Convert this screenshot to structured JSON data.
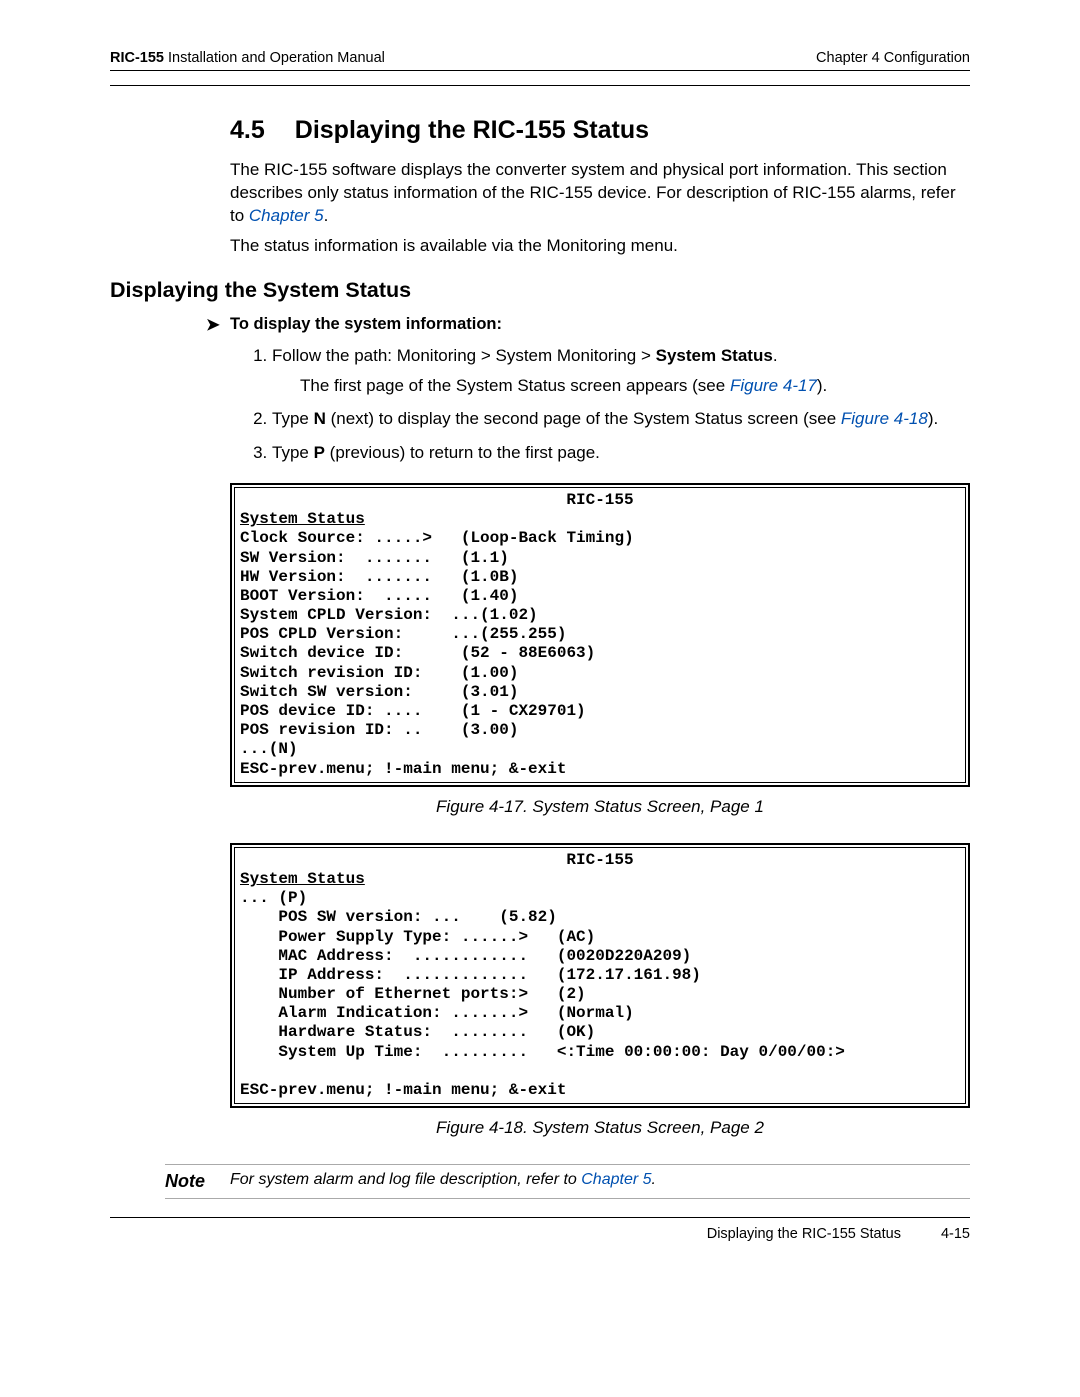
{
  "header": {
    "product": "RIC-155",
    "doc_title": "Installation and Operation Manual",
    "chapter": "Chapter 4  Configuration"
  },
  "section": {
    "number": "4.5",
    "title": "Displaying the RIC-155 Status"
  },
  "intro": {
    "p1": "The RIC-155 software displays the converter system and physical port information. This section describes only status information of the RIC-155 device. For description of RIC-155 alarms, refer to ",
    "chapter5_link": "Chapter 5",
    "p1_end": ".",
    "p2": "The status information is available via the Monitoring menu."
  },
  "sub_heading": "Displaying the System Status",
  "proc_title": "To display the system information:",
  "steps": {
    "s1_a": "Follow the path: Monitoring > System Monitoring > ",
    "s1_b": "System Status",
    "s1_c": ".",
    "s1_sub_a": "The first page of the System Status screen appears (see ",
    "s1_sub_link": "Figure 4-17",
    "s1_sub_b": ").",
    "s2_a": "Type ",
    "s2_n": "N",
    "s2_b": " (next) to display the second page of the System Status screen (see ",
    "s2_link": "Figure 4-18",
    "s2_c": ").",
    "s3_a": "Type ",
    "s3_p": "P",
    "s3_b": " (previous) to return to the first page."
  },
  "screen1": {
    "title": "RIC-155",
    "subtitle": "System Status",
    "lines": [
      "Clock Source: .....>   (Loop-Back Timing)",
      "SW Version:  .......   (1.1)",
      "HW Version:  .......   (1.0B)",
      "BOOT Version:  .....   (1.40)",
      "System CPLD Version:  ...(1.02)",
      "POS CPLD Version:     ...(255.255)",
      "Switch device ID:      (52 - 88E6063)",
      "Switch revision ID:    (1.00)",
      "Switch SW version:     (3.01)",
      "POS device ID: ....    (1 - CX29701)",
      "POS revision ID: ..    (3.00)",
      "...(N)"
    ],
    "footer": "ESC-prev.menu; !-main menu; &-exit",
    "caption": "Figure 4-17.  System Status Screen, Page 1"
  },
  "screen2": {
    "title": "RIC-155",
    "subtitle": "System Status",
    "lines": [
      "... (P)",
      "    POS SW version: ...    (5.82)",
      "    Power Supply Type: ......>   (AC)",
      "    MAC Address:  ............   (0020D220A209)",
      "    IP Address:  .............   (172.17.161.98)",
      "    Number of Ethernet ports:>   (2)",
      "    Alarm Indication: .......>   (Normal)",
      "    Hardware Status:  ........   (OK)",
      "    System Up Time:  .........   <:Time 00:00:00: Day 0/00/00:>",
      ""
    ],
    "footer": "ESC-prev.menu; !-main menu; &-exit",
    "caption": "Figure 4-18.  System Status Screen, Page 2"
  },
  "note": {
    "label": "Note",
    "text_a": "For system alarm and log file description, refer to ",
    "link": "Chapter 5",
    "text_b": "."
  },
  "footer": {
    "title": "Displaying the RIC-155 Status",
    "page": "4-15"
  }
}
